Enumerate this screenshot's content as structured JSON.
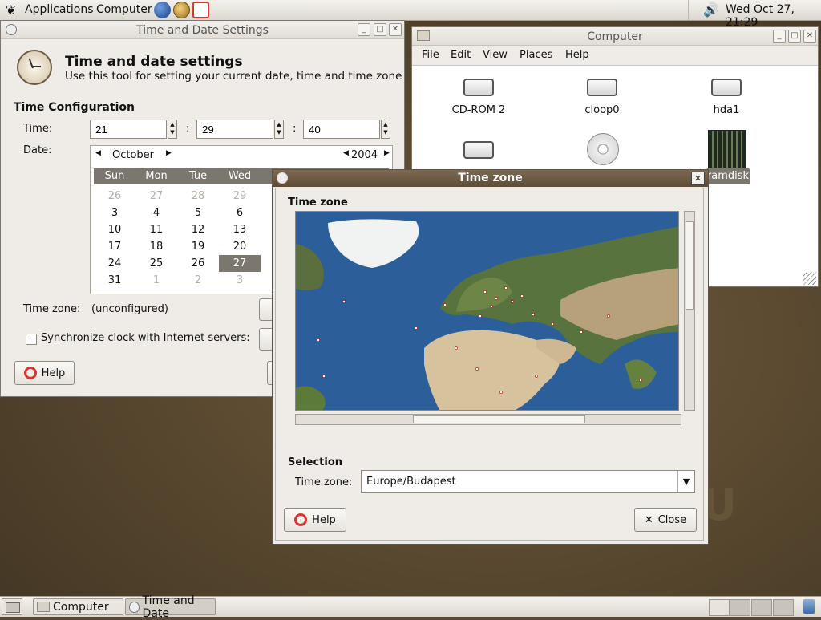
{
  "top_panel": {
    "menus": [
      "Applications",
      "Computer"
    ],
    "launchers": [
      "web-browser-icon",
      "email-client-icon",
      "help-icon"
    ],
    "clock": "Wed Oct 27, 21:29"
  },
  "tds_window": {
    "title": "Time and Date Settings",
    "header_title": "Time and date settings",
    "header_desc": "Use this tool for setting your current date, time and time zone",
    "section": "Time Configuration",
    "time_label": "Time:",
    "date_label": "Date:",
    "hour": "21",
    "minute": "29",
    "second": "40",
    "sep": ":",
    "month": "October",
    "year": "2004",
    "weekdays": [
      "Sun",
      "Mon",
      "Tue",
      "Wed"
    ],
    "calendar_rows": [
      [
        "26",
        "27",
        "28",
        "29"
      ],
      [
        "3",
        "4",
        "5",
        "6"
      ],
      [
        "10",
        "11",
        "12",
        "13"
      ],
      [
        "17",
        "18",
        "19",
        "20"
      ],
      [
        "24",
        "25",
        "26",
        "27"
      ],
      [
        "31",
        "1",
        "2",
        "3"
      ]
    ],
    "selected_day": "27",
    "timezone_label": "Time zone:",
    "timezone_value": "(unconfigured)",
    "sync_label": "Synchronize clock with Internet servers:",
    "help_button": "Help"
  },
  "computer_window": {
    "title": "Computer",
    "menus": [
      "File",
      "Edit",
      "View",
      "Places",
      "Help"
    ],
    "items": [
      {
        "label": "CD-ROM 2",
        "icon": "drive-icon"
      },
      {
        "label": "cloop0",
        "icon": "drive-icon"
      },
      {
        "label": "hda1",
        "icon": "drive-icon"
      },
      {
        "label": "",
        "icon": "drive-icon"
      },
      {
        "label": "",
        "icon": "cdrom-disc-icon"
      },
      {
        "label": "ramdisk",
        "icon": "memory-chip-icon"
      }
    ]
  },
  "tz_dialog": {
    "title": "Time zone",
    "section": "Time zone",
    "selection_section": "Selection",
    "field_label": "Time zone:",
    "field_value": "Europe/Budapest",
    "help_button": "Help",
    "close_button": "Close"
  },
  "taskbar": {
    "tasks": [
      "Computer",
      "Time and Date"
    ]
  },
  "colors": {
    "title_active": "#6b5940",
    "selection": "#7c776e",
    "ocean": "#2d5f9a"
  }
}
